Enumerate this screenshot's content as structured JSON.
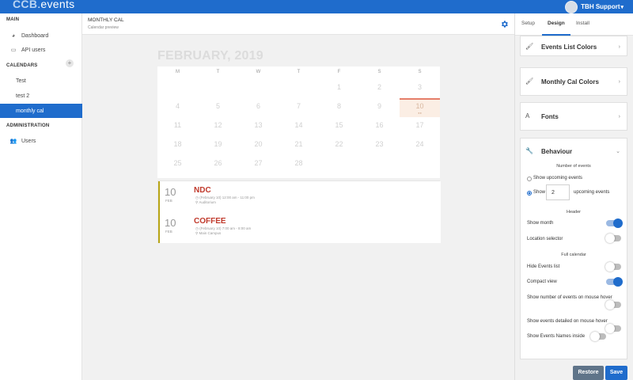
{
  "app": {
    "logo_main": "CCB",
    "logo_accent": ".events",
    "user_name": "TBH Support"
  },
  "sidebar": {
    "main_title": "MAIN",
    "dashboard": "Dashboard",
    "api_users": "API users",
    "calendars_title": "CALENDARS",
    "add_calendar": "+",
    "calendars": [
      "Test",
      "test 2",
      "monthly cal"
    ],
    "administration_title": "ADMINISTRATION",
    "users": "Users"
  },
  "header": {
    "title": "MONTHLY CAL",
    "subtitle": "Calendar preview"
  },
  "calendar": {
    "month_title": "FEBRUARY, 2019",
    "weekdays": [
      "M",
      "T",
      "W",
      "T",
      "F",
      "S",
      "S"
    ],
    "weeks": [
      [
        "",
        "",
        "",
        "",
        "1",
        "2",
        "3"
      ],
      [
        "4",
        "5",
        "6",
        "7",
        "8",
        "9",
        "10"
      ],
      [
        "11",
        "12",
        "13",
        "14",
        "15",
        "16",
        "17"
      ],
      [
        "18",
        "19",
        "20",
        "21",
        "22",
        "23",
        "24"
      ],
      [
        "25",
        "26",
        "27",
        "28",
        "",
        "",
        ""
      ]
    ],
    "today": "10"
  },
  "events": [
    {
      "day": "10",
      "month": "FEB",
      "name": "NDC",
      "time": "(February 10) 12:00 am - 11:00 pm",
      "location": "Auditorium"
    },
    {
      "day": "10",
      "month": "FEB",
      "name": "COFFEE",
      "time": "(February 10) 7:00 am - 8:00 am",
      "location": "Main Campus"
    }
  ],
  "panel": {
    "tabs": [
      "Setup",
      "Design",
      "Install"
    ],
    "active_tab": "Design",
    "cards": {
      "events_list_colors": "Events List Colors",
      "monthly_cal_colors": "Monthly Cal Colors",
      "fonts": "Fonts",
      "behaviour": "Behaviour"
    },
    "number_of_events": "Number of events",
    "show_upcoming": "Show upcoming events",
    "show": "Show",
    "show_count": "2",
    "upcoming_events": "upcoming events",
    "header_section": "Header",
    "show_month": "Show month",
    "location_selector": "Location selector",
    "full_calendar": "Full calendar",
    "hide_events_list": "Hide Events list",
    "compact_view": "Compact view",
    "show_number_hover": "Show number of events on mouse hover",
    "show_detailed_hover": "Show events detailed on mouse hover",
    "show_names_inside": "Show Events Names inside",
    "toggles": {
      "show_month": true,
      "location_selector": false,
      "hide_events_list": false,
      "compact_view": true,
      "show_number_hover": false,
      "show_detailed_hover": false,
      "show_names_inside": false
    }
  },
  "buttons": {
    "restore": "Restore",
    "save": "Save"
  },
  "colors": {
    "primary": "#1f6ccc",
    "event_title": "#c0392b",
    "event_bar": "#b8a516",
    "today_accent": "#e57e6a"
  }
}
